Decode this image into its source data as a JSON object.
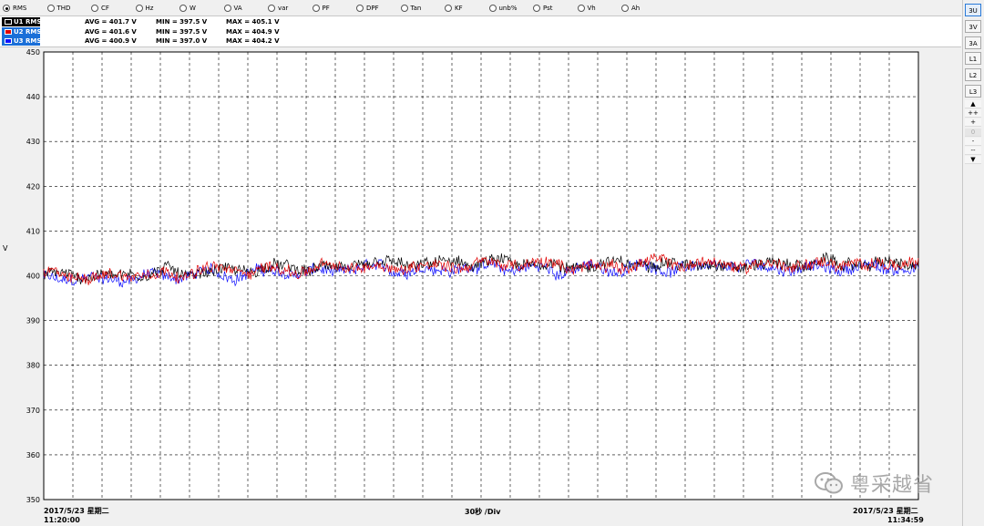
{
  "toolbar": {
    "options": [
      {
        "label": "RMS",
        "selected": true
      },
      {
        "label": "THD",
        "selected": false
      },
      {
        "label": "CF",
        "selected": false
      },
      {
        "label": "Hz",
        "selected": false
      },
      {
        "label": "W",
        "selected": false
      },
      {
        "label": "VA",
        "selected": false
      },
      {
        "label": "var",
        "selected": false
      },
      {
        "label": "PF",
        "selected": false
      },
      {
        "label": "DPF",
        "selected": false
      },
      {
        "label": "Tan",
        "selected": false
      },
      {
        "label": "KF",
        "selected": false
      },
      {
        "label": "unb%",
        "selected": false
      },
      {
        "label": "Pst",
        "selected": false
      },
      {
        "label": "Vh",
        "selected": false
      },
      {
        "label": "Ah",
        "selected": false
      }
    ]
  },
  "legend": [
    {
      "name": "U1 RMS",
      "color": "#000000",
      "avg": "AVG = 401.7 V",
      "min": "MIN = 397.5 V",
      "max": "MAX = 405.1 V"
    },
    {
      "name": "U2 RMS",
      "color": "#e00000",
      "avg": "AVG = 401.6 V",
      "min": "MIN = 397.5 V",
      "max": "MAX = 404.9 V"
    },
    {
      "name": "U3 RMS",
      "color": "#1010ff",
      "avg": "AVG = 400.9 V",
      "min": "MIN = 397.0 V",
      "max": "MAX = 404.2 V"
    }
  ],
  "sidebar": {
    "buttons": [
      {
        "label": "3U",
        "active": true
      },
      {
        "label": "3V",
        "active": false
      },
      {
        "label": "3A",
        "active": false
      },
      {
        "label": "L1",
        "active": false
      },
      {
        "label": "L2",
        "active": false
      },
      {
        "label": "L3",
        "active": false
      }
    ],
    "steps": [
      {
        "label": "▲",
        "dim": false
      },
      {
        "label": "++",
        "dim": false
      },
      {
        "label": "+",
        "dim": false
      },
      {
        "label": "0",
        "dim": true
      },
      {
        "label": "-",
        "dim": false
      },
      {
        "label": "--",
        "dim": false
      },
      {
        "label": "▼",
        "dim": false
      }
    ]
  },
  "footer": {
    "start_date": "2017/5/23 星期二",
    "start_time": "11:20:00",
    "division": "30秒 /Div",
    "end_date": "2017/5/23 星期二",
    "end_time": "11:34:59"
  },
  "watermark": {
    "text": "粤采越省",
    "icon": "wechat-icon"
  },
  "chart_data": {
    "type": "line",
    "ylabel": "V",
    "ylim": [
      350,
      450
    ],
    "yticks": [
      350,
      360,
      370,
      380,
      390,
      400,
      410,
      420,
      430,
      440,
      450
    ],
    "x_start": "11:20:00",
    "x_end": "11:34:59",
    "x_division": "30秒 /Div",
    "grid": true,
    "series": [
      {
        "name": "U1 RMS",
        "color": "#000000",
        "avg": 401.7,
        "min": 397.5,
        "max": 405.1,
        "trend": [
          400.2,
          400.0,
          400.6,
          401.0,
          401.2,
          401.6,
          401.4,
          401.9,
          402.2,
          402.6,
          402.8,
          402.5,
          402.3,
          402.5,
          402.9,
          402.7,
          402.5,
          402.8,
          402.6,
          402.7,
          402.6
        ]
      },
      {
        "name": "U2 RMS",
        "color": "#e00000",
        "avg": 401.6,
        "min": 397.5,
        "max": 404.9,
        "trend": [
          400.1,
          399.9,
          400.5,
          400.9,
          401.1,
          401.5,
          401.3,
          401.8,
          402.1,
          402.5,
          402.7,
          402.4,
          402.2,
          402.4,
          402.8,
          402.6,
          402.4,
          402.7,
          402.5,
          402.6,
          402.5
        ]
      },
      {
        "name": "U3 RMS",
        "color": "#1010ff",
        "avg": 400.9,
        "min": 397.0,
        "max": 404.2,
        "trend": [
          399.3,
          399.1,
          399.7,
          400.1,
          400.4,
          400.8,
          400.6,
          401.1,
          401.4,
          401.7,
          401.9,
          401.6,
          401.4,
          401.6,
          402.0,
          401.8,
          401.6,
          401.9,
          401.7,
          401.8,
          401.7
        ]
      }
    ]
  }
}
